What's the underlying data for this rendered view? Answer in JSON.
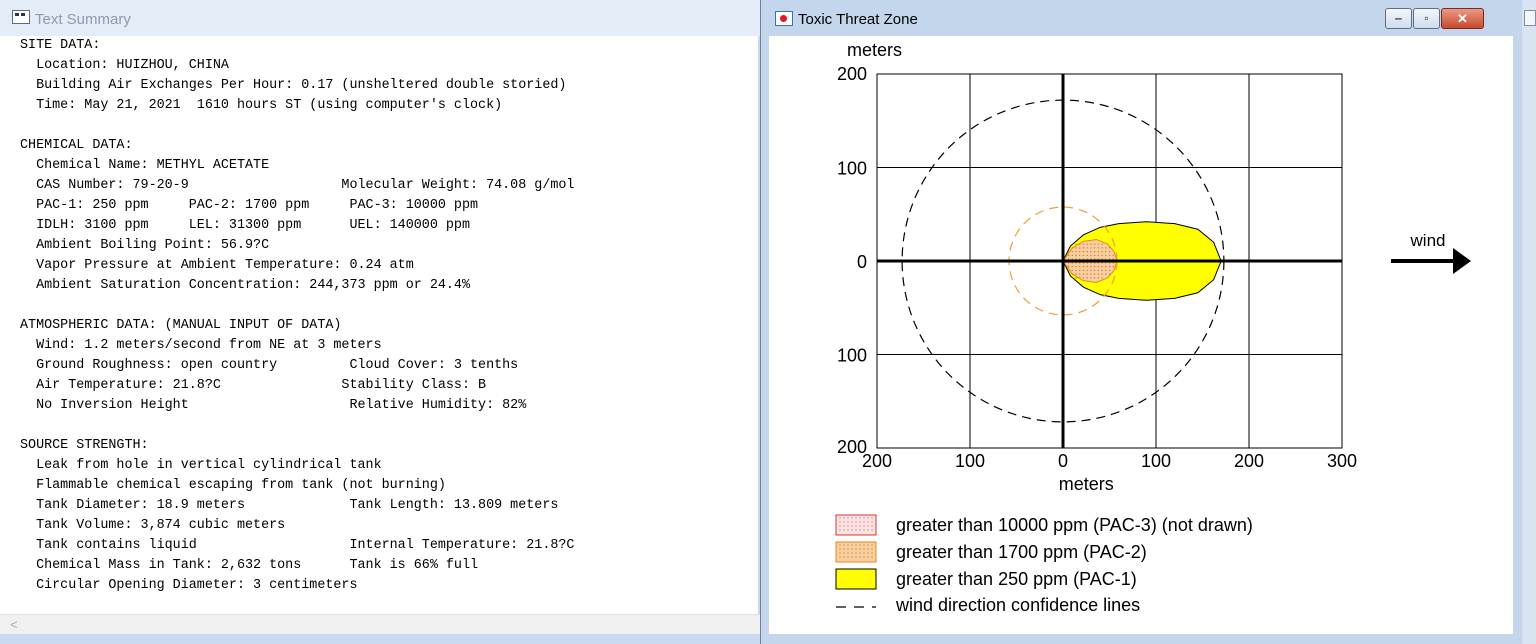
{
  "text_summary": {
    "title": "Text Summary",
    "lines": [
      "SITE DATA:",
      "  Location: HUIZHOU, CHINA",
      "  Building Air Exchanges Per Hour: 0.17 (unsheltered double storied)",
      "  Time: May 21, 2021  1610 hours ST (using computer's clock)",
      "",
      "CHEMICAL DATA:",
      "  Chemical Name: METHYL ACETATE",
      "  CAS Number: 79-20-9                   Molecular Weight: 74.08 g/mol",
      "  PAC-1: 250 ppm     PAC-2: 1700 ppm     PAC-3: 10000 ppm",
      "  IDLH: 3100 ppm     LEL: 31300 ppm      UEL: 140000 ppm",
      "  Ambient Boiling Point: 56.9?C",
      "  Vapor Pressure at Ambient Temperature: 0.24 atm",
      "  Ambient Saturation Concentration: 244,373 ppm or 24.4%",
      "",
      "ATMOSPHERIC DATA: (MANUAL INPUT OF DATA)",
      "  Wind: 1.2 meters/second from NE at 3 meters",
      "  Ground Roughness: open country         Cloud Cover: 3 tenths",
      "  Air Temperature: 21.8?C               Stability Class: B",
      "  No Inversion Height                    Relative Humidity: 82%",
      "",
      "SOURCE STRENGTH:",
      "  Leak from hole in vertical cylindrical tank",
      "  Flammable chemical escaping from tank (not burning)",
      "  Tank Diameter: 18.9 meters             Tank Length: 13.809 meters",
      "  Tank Volume: 3,874 cubic meters",
      "  Tank contains liquid                   Internal Temperature: 21.8?C",
      "  Chemical Mass in Tank: 2,632 tons      Tank is 66% full",
      "  Circular Opening Diameter: 3 centimeters"
    ],
    "scroll_left_glyph": "<"
  },
  "threat_zone": {
    "title": "Toxic Threat Zone",
    "controls": {
      "minimize": "‒",
      "maximize": "▫",
      "close": "✕"
    },
    "wind_label": "wind",
    "legend": [
      {
        "label": "greater than 10000 ppm (PAC-3) (not drawn)",
        "fill": "#fbe4e4",
        "border": "#e53030"
      },
      {
        "label": "greater than 1700 ppm (PAC-2)",
        "fill": "#f7cfa0",
        "border": "#e88a1e"
      },
      {
        "label": "greater than 250 ppm (PAC-1)",
        "fill": "#ffff00",
        "border": "#000000"
      },
      {
        "label": "wind direction confidence lines",
        "fill": "none",
        "border": "#000000"
      }
    ]
  },
  "chart_data": {
    "type": "scatter",
    "title": "",
    "xlabel": "meters",
    "ylabel": "meters",
    "xlim": [
      -200,
      300
    ],
    "ylim": [
      -200,
      200
    ],
    "x_ticks": [
      -200,
      -100,
      0,
      100,
      200,
      300
    ],
    "x_tick_labels": [
      "200",
      "100",
      "0",
      "100",
      "200",
      "300"
    ],
    "y_ticks": [
      200,
      100,
      0,
      -100,
      -200
    ],
    "y_tick_labels": [
      "200",
      "100",
      "0",
      "100",
      "200"
    ],
    "grid": true,
    "zones": [
      {
        "name": "greater than 1700 ppm (PAC-2)",
        "color": "#f7cfa0",
        "points": [
          [
            0,
            0
          ],
          [
            10,
            14
          ],
          [
            22,
            21
          ],
          [
            36,
            23
          ],
          [
            48,
            18
          ],
          [
            55,
            10
          ],
          [
            58,
            0
          ],
          [
            55,
            -10
          ],
          [
            48,
            -18
          ],
          [
            36,
            -23
          ],
          [
            22,
            -21
          ],
          [
            10,
            -14
          ]
        ]
      },
      {
        "name": "greater than 250 ppm (PAC-1)",
        "color": "#ffff00",
        "points": [
          [
            0,
            0
          ],
          [
            8,
            16
          ],
          [
            22,
            28
          ],
          [
            40,
            36
          ],
          [
            60,
            40
          ],
          [
            90,
            42
          ],
          [
            120,
            40
          ],
          [
            145,
            34
          ],
          [
            162,
            20
          ],
          [
            170,
            0
          ],
          [
            162,
            -20
          ],
          [
            145,
            -34
          ],
          [
            120,
            -40
          ],
          [
            90,
            -42
          ],
          [
            60,
            -40
          ],
          [
            40,
            -36
          ],
          [
            22,
            -28
          ],
          [
            8,
            -16
          ]
        ]
      }
    ],
    "circles": [
      {
        "name": "wind direction confidence lines",
        "cx": 0,
        "cy": 0,
        "r": 173,
        "color": "#000000",
        "dashed": true
      },
      {
        "name": "PAC-2 confidence circle",
        "cx": 0,
        "cy": 0,
        "r": 58,
        "color": "#f0a030",
        "dashed": true
      }
    ]
  }
}
